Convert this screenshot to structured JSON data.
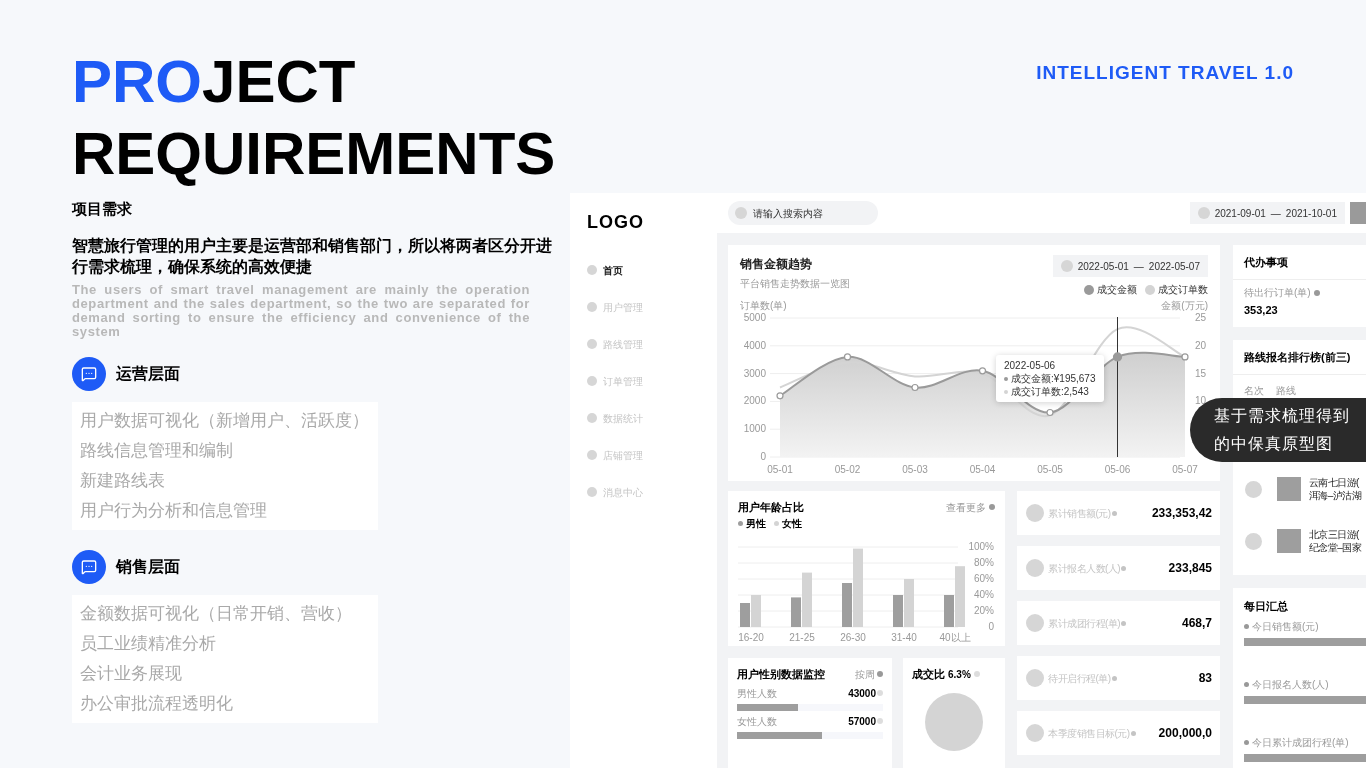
{
  "title_lines": [
    {
      "parts": [
        {
          "text": "PRO",
          "accent": true
        },
        {
          "text": "JECT",
          "accent": false
        }
      ]
    },
    {
      "parts": [
        {
          "text": "REQUIREMENTS",
          "accent": false
        }
      ]
    }
  ],
  "badge": "INTELLIGENT TRAVEL 1.0",
  "subtitle": "项目需求",
  "summary": "智慧旅行管理的用户主要是运营部和销售部门，所以将两者区分开进行需求梳理，确保系统的高效便捷",
  "summary_en": "The users of smart travel management are mainly the operation department and the sales department, so the two are separated for demand sorting to ensure the efficiency and convenience of the system",
  "sections": [
    {
      "title": "运营层面",
      "items": [
        "用户数据可视化（新增用户、活跃度）",
        "路线信息管理和编制",
        "新建路线表",
        "用户行为分析和信息管理"
      ]
    },
    {
      "title": "销售层面",
      "items": [
        "金额数据可视化（日常开销、营收）",
        "员工业绩精准分析",
        "会计业务展现",
        "办公审批流程透明化"
      ]
    }
  ],
  "prototype": {
    "logo": "LOGO",
    "nav": [
      {
        "label": "首页",
        "selected": true
      },
      {
        "label": "用户管理",
        "selected": false
      },
      {
        "label": "路线管理",
        "selected": false
      },
      {
        "label": "订单管理",
        "selected": false
      },
      {
        "label": "数据统计",
        "selected": false
      },
      {
        "label": "店铺管理",
        "selected": false
      },
      {
        "label": "消息中心",
        "selected": false
      }
    ],
    "search": {
      "placeholder": "请输入搜索内容"
    },
    "date_range": {
      "start": "2021-09-01",
      "sep": "—",
      "end": "2021-10-01"
    },
    "sales_trend": {
      "title": "销售金额趋势",
      "subtitle": "平台销售走势数据一览图",
      "date_range": {
        "start": "2022-05-01",
        "sep": "—",
        "end": "2022-05-07"
      },
      "tooltip": {
        "date": "2022-05-06",
        "lines": [
          "成交金额:¥195,673",
          "成交订单数:2,543"
        ]
      },
      "chart_data": {
        "type": "line",
        "grid": true,
        "ylabel": "订单数(单)",
        "y2label": "金额(万元)",
        "categories": [
          "05-01",
          "05-02",
          "05-03",
          "05-04",
          "05-05",
          "05-06",
          "05-07"
        ],
        "series": [
          {
            "name": "成交金额",
            "color": "#9a9a9a",
            "type": "area",
            "values": [
              2200,
              3600,
              2500,
              3100,
              1600,
              3600,
              3600
            ]
          },
          {
            "name": "成交订单数",
            "color": "#d4d4d4",
            "type": "line",
            "values": [
              2500,
              3400,
              2900,
              3000,
              1500,
              4600,
              3600
            ]
          }
        ],
        "ylim": [
          0,
          5000
        ],
        "yticks": [
          0,
          1000,
          2000,
          3000,
          4000,
          5000
        ],
        "y2lim": [
          0,
          25
        ],
        "ref_lines": [
          {
            "axis": "x",
            "value": "05-06"
          }
        ],
        "y2ticks": [
          10,
          15,
          20,
          25
        ]
      }
    },
    "age": {
      "title": "用户年龄占比",
      "more": "查看更多",
      "chart_data": {
        "type": "bar",
        "grid": true,
        "categories": [
          "16-20",
          "21-25",
          "26-30",
          "31-40",
          "40以上"
        ],
        "series": [
          {
            "name": "男性",
            "color": "#9e9e9e",
            "values": [
              30,
              37,
              55,
              40,
              40
            ]
          },
          {
            "name": "女性",
            "color": "#d4d4d4",
            "values": [
              40,
              68,
              98,
              60,
              76
            ]
          }
        ],
        "ylim": [
          0,
          100
        ],
        "yticks": [
          {
            "value": 0,
            "label": "0"
          },
          {
            "value": 20,
            "label": "20%"
          },
          {
            "value": 40,
            "label": "40%"
          },
          {
            "value": 60,
            "label": "60%"
          },
          {
            "value": 80,
            "label": "80%"
          },
          {
            "value": 100,
            "label": "100%"
          }
        ]
      }
    },
    "gender": {
      "title": "用户性别数据监控",
      "filter": "按周",
      "rows": [
        {
          "label": "男性人数",
          "value": "43000",
          "level": 0.42
        },
        {
          "label": "女性人数",
          "value": "57000",
          "level": 0.58
        }
      ]
    },
    "ratio": {
      "title": "成交比",
      "value": "6.3%"
    },
    "stats": [
      {
        "label": "累计销售额(元)",
        "value": "233,353,42"
      },
      {
        "label": "累计报名人数(人)",
        "value": "233,845"
      },
      {
        "label": "累计成团行程(单)",
        "value": "468,7"
      },
      {
        "label": "待开启行程(单)",
        "value": "83"
      },
      {
        "label": "本季度销售目标(元)",
        "value": "200,000,0"
      }
    ],
    "todo": {
      "title": "代办事项",
      "label": "待出行订单(单)",
      "value": "353,23"
    },
    "ranking": {
      "title": "路线报名排行榜(前三)",
      "columns": [
        "名次",
        "路线"
      ],
      "rows": [
        {},
        {
          "lines": [
            "云南七日游(",
            "洱海–泸沽湖"
          ]
        },
        {
          "lines": [
            "北京三日游(",
            "纪念堂–国家"
          ]
        }
      ]
    },
    "daily": {
      "title": "每日汇总",
      "items": [
        "今日销售额(元)",
        "今日报名人数(人)",
        "今日累计成团行程(单)"
      ]
    },
    "note": [
      "基于需求梳理得到",
      "的中保真原型图"
    ]
  }
}
